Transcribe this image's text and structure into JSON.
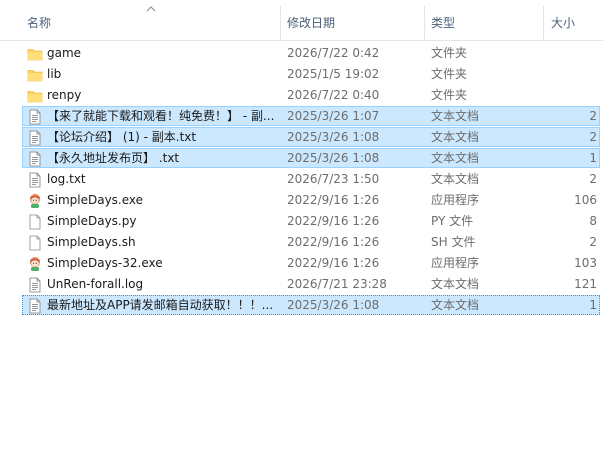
{
  "columns": {
    "name": "名称",
    "date": "修改日期",
    "type": "类型",
    "size": "大小"
  },
  "files": [
    {
      "icon": "folder-icon",
      "name": "game",
      "date": "2026/7/22 0:42",
      "type": "文件夹",
      "size": "",
      "selected": false
    },
    {
      "icon": "folder-icon",
      "name": "lib",
      "date": "2025/1/5 19:02",
      "type": "文件夹",
      "size": "",
      "selected": false
    },
    {
      "icon": "folder-icon",
      "name": "renpy",
      "date": "2026/7/22 0:40",
      "type": "文件夹",
      "size": "",
      "selected": false
    },
    {
      "icon": "text-file-icon",
      "name": "【来了就能下载和观看！纯免费！】 - 副...",
      "date": "2025/3/26 1:07",
      "type": "文本文档",
      "size": "2",
      "selected": true
    },
    {
      "icon": "text-file-icon",
      "name": "【论坛介绍】 (1) - 副本.txt",
      "date": "2025/3/26 1:08",
      "type": "文本文档",
      "size": "2",
      "selected": true
    },
    {
      "icon": "text-file-icon",
      "name": "【永久地址发布页】 .txt",
      "date": "2025/3/26 1:08",
      "type": "文本文档",
      "size": "1",
      "selected": true
    },
    {
      "icon": "text-file-icon",
      "name": "log.txt",
      "date": "2026/7/23 1:50",
      "type": "文本文档",
      "size": "2",
      "selected": false
    },
    {
      "icon": "app-icon",
      "name": "SimpleDays.exe",
      "date": "2022/9/16 1:26",
      "type": "应用程序",
      "size": "106",
      "selected": false
    },
    {
      "icon": "blank-file-icon",
      "name": "SimpleDays.py",
      "date": "2022/9/16 1:26",
      "type": "PY 文件",
      "size": "8",
      "selected": false
    },
    {
      "icon": "blank-file-icon",
      "name": "SimpleDays.sh",
      "date": "2022/9/16 1:26",
      "type": "SH 文件",
      "size": "2",
      "selected": false
    },
    {
      "icon": "app-icon",
      "name": "SimpleDays-32.exe",
      "date": "2022/9/16 1:26",
      "type": "应用程序",
      "size": "103",
      "selected": false
    },
    {
      "icon": "text-file-icon",
      "name": "UnRen-forall.log",
      "date": "2026/7/21 23:28",
      "type": "文本文档",
      "size": "121",
      "selected": false
    },
    {
      "icon": "text-file-icon",
      "name": "最新地址及APP请发邮箱自动获取！！！...",
      "date": "2025/3/26 1:08",
      "type": "文本文档",
      "size": "1",
      "selected": true,
      "focused": true
    }
  ],
  "colors": {
    "selection": "#cce8ff",
    "selection_border": "#99d1ff",
    "folder": "#ffd35a",
    "header_text": "#4c607a"
  }
}
